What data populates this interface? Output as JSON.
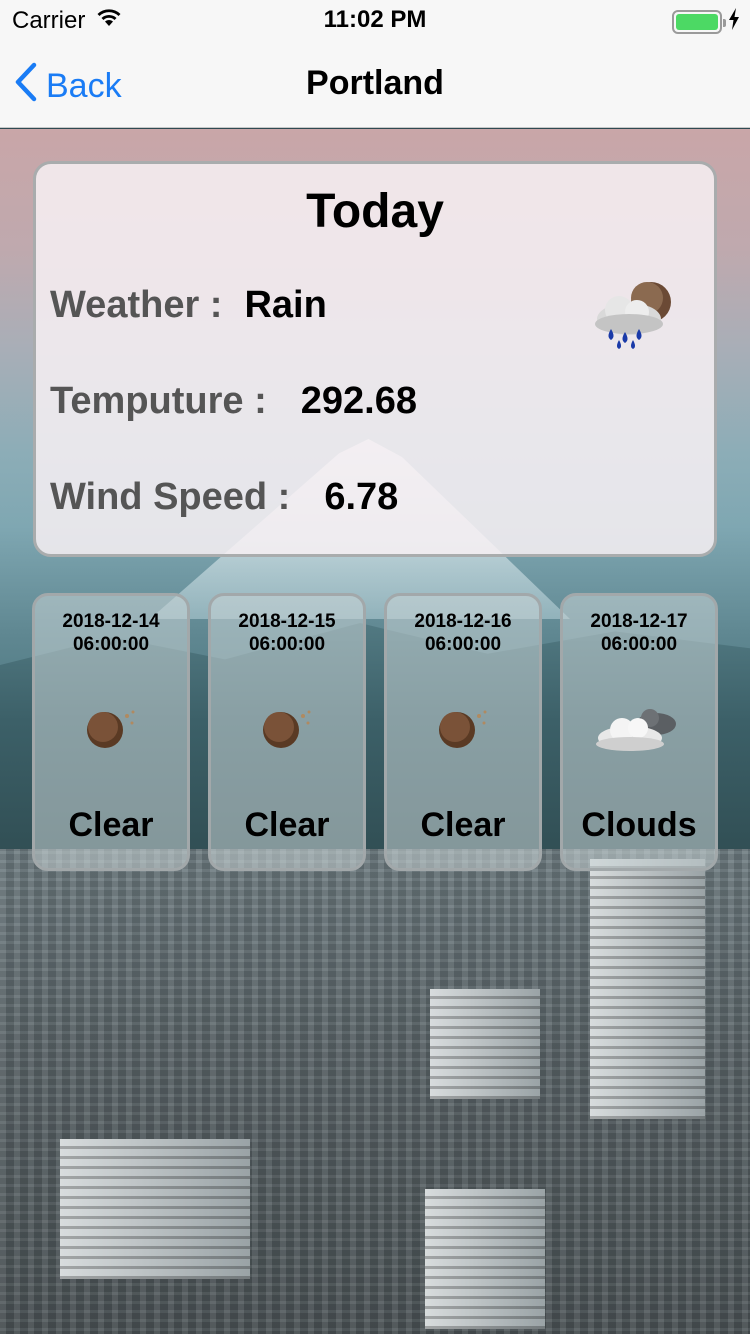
{
  "status_bar": {
    "carrier": "Carrier",
    "time": "11:02 PM",
    "icons": [
      "wifi-icon",
      "battery-icon",
      "charging-bolt-icon"
    ],
    "battery_color": "#4cd964"
  },
  "nav": {
    "back_label": "Back",
    "title": "Portland",
    "accent_color": "#1a7cf5"
  },
  "today": {
    "title": "Today",
    "weather_label": "Weather :",
    "weather_value": "Rain",
    "weather_icon": "rain-clouds-icon",
    "temp_label": "Temputure :",
    "temp_value": "292.68",
    "wind_label": "Wind Speed :",
    "wind_value": "6.78"
  },
  "forecast": [
    {
      "date": "2018-12-14",
      "time": "06:00:00",
      "condition": "Clear",
      "icon": "clear-moon-icon"
    },
    {
      "date": "2018-12-15",
      "time": "06:00:00",
      "condition": "Clear",
      "icon": "clear-moon-icon"
    },
    {
      "date": "2018-12-16",
      "time": "06:00:00",
      "condition": "Clear",
      "icon": "clear-moon-icon"
    },
    {
      "date": "2018-12-17",
      "time": "06:00:00",
      "condition": "Clouds",
      "icon": "clouds-icon"
    }
  ]
}
